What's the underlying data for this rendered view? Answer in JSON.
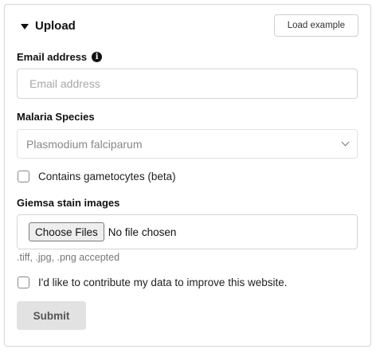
{
  "section": {
    "title": "Upload",
    "load_example_label": "Load example"
  },
  "email": {
    "label": "Email address",
    "placeholder": "Email address",
    "value": ""
  },
  "species": {
    "label": "Malaria Species",
    "selected": "Plasmodium falciparum"
  },
  "gametocytes": {
    "label": "Contains gametocytes (beta)",
    "checked": false
  },
  "images": {
    "label": "Giemsa stain images",
    "choose_label": "Choose Files",
    "status": "No file chosen",
    "hint": ".tiff, .jpg, .png accepted"
  },
  "contribute": {
    "label": "I'd like to contribute my data to improve this website.",
    "checked": false
  },
  "submit_label": "Submit",
  "icons": {
    "info": "info-icon",
    "caret": "caret-down-icon",
    "select_chevron": "chevron-down-icon"
  }
}
